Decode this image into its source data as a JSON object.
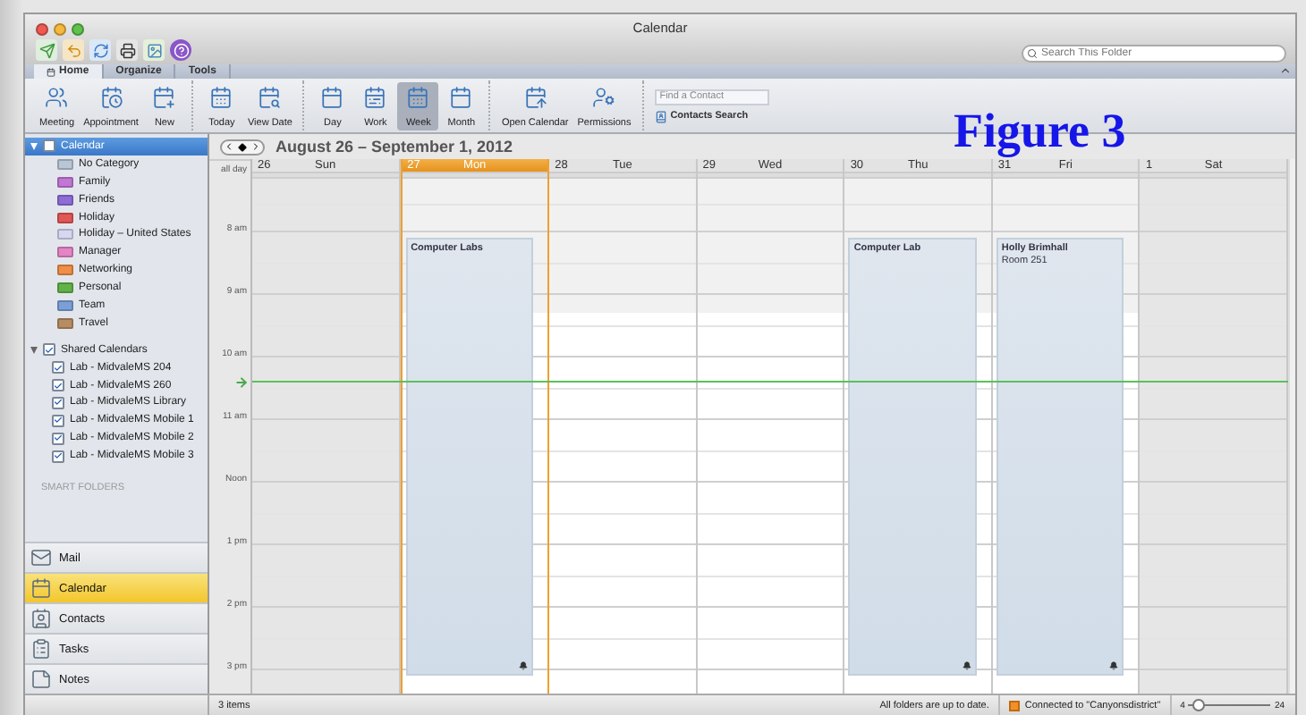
{
  "window": {
    "title": "Calendar"
  },
  "search": {
    "placeholder": "Search This Folder"
  },
  "tabs": [
    {
      "label": "Home",
      "selected": true
    },
    {
      "label": "Organize",
      "selected": false
    },
    {
      "label": "Tools",
      "selected": false
    }
  ],
  "ribbon": {
    "groups": [
      [
        {
          "label": "Meeting",
          "kind": "meeting",
          "selected": false
        },
        {
          "label": "Appointment",
          "kind": "appointment",
          "selected": false
        },
        {
          "label": "New",
          "kind": "new",
          "selected": false
        }
      ],
      [
        {
          "label": "Today",
          "kind": "today",
          "selected": false
        },
        {
          "label": "View Date",
          "kind": "viewdate",
          "selected": false
        }
      ],
      [
        {
          "label": "Day",
          "kind": "day",
          "selected": false
        },
        {
          "label": "Work",
          "kind": "work",
          "selected": false
        },
        {
          "label": "Week",
          "kind": "week",
          "selected": true
        },
        {
          "label": "Month",
          "kind": "month",
          "selected": false
        }
      ],
      [
        {
          "label": "Open Calendar",
          "kind": "open",
          "selected": false
        },
        {
          "label": "Permissions",
          "kind": "permissions",
          "selected": false
        }
      ]
    ],
    "find_contact": {
      "placeholder": "Find a Contact"
    },
    "contacts_search": "Contacts Search"
  },
  "figure_label": "Figure 3",
  "sidebar": {
    "calendar": {
      "label": "Calendar",
      "checked": false,
      "expanded": true,
      "selected": true,
      "categories": [
        {
          "label": "No Category",
          "color": "#b9c6d6"
        },
        {
          "label": "Family",
          "color": "#c276d6"
        },
        {
          "label": "Friends",
          "color": "#8e6cd8"
        },
        {
          "label": "Holiday",
          "color": "#e25656"
        },
        {
          "label": "Holiday – United States",
          "color": "#d6d8f2"
        },
        {
          "label": "Manager",
          "color": "#e485c6"
        },
        {
          "label": "Networking",
          "color": "#f08e46"
        },
        {
          "label": "Personal",
          "color": "#62b24a"
        },
        {
          "label": "Team",
          "color": "#7c9fd8"
        },
        {
          "label": "Travel",
          "color": "#b68c62"
        }
      ]
    },
    "shared": {
      "label": "Shared Calendars",
      "checked": true,
      "expanded": true,
      "children": [
        {
          "label": "Lab - MidvaleMS 204",
          "checked": true
        },
        {
          "label": "Lab - MidvaleMS 260",
          "checked": true
        },
        {
          "label": "Lab - MidvaleMS Library",
          "checked": true
        },
        {
          "label": "Lab - MidvaleMS Mobile 1",
          "checked": true
        },
        {
          "label": "Lab - MidvaleMS Mobile 2",
          "checked": true
        },
        {
          "label": "Lab - MidvaleMS Mobile 3",
          "checked": true
        }
      ]
    },
    "smart_folders": "SMART FOLDERS"
  },
  "nav": [
    {
      "label": "Mail",
      "kind": "mail",
      "selected": false
    },
    {
      "label": "Calendar",
      "kind": "calendar",
      "selected": true
    },
    {
      "label": "Contacts",
      "kind": "contacts",
      "selected": false
    },
    {
      "label": "Tasks",
      "kind": "tasks",
      "selected": false
    },
    {
      "label": "Notes",
      "kind": "notes",
      "selected": false
    }
  ],
  "calendar": {
    "title": "August 26 – September 1, 2012",
    "all_day_label": "all day",
    "hours": [
      "8 am",
      "9 am",
      "10 am",
      "11 am",
      "Noon",
      "1 pm",
      "2 pm",
      "3 pm"
    ],
    "days": [
      {
        "number": "26",
        "name": "Sun",
        "selected": false,
        "weekend": true
      },
      {
        "number": "27",
        "name": "Mon",
        "selected": true,
        "weekend": false,
        "events": [
          {
            "title": "Computer Labs",
            "alarm": true
          }
        ]
      },
      {
        "number": "28",
        "name": "Tue",
        "selected": false,
        "weekend": false
      },
      {
        "number": "29",
        "name": "Wed",
        "selected": false,
        "weekend": false
      },
      {
        "number": "30",
        "name": "Thu",
        "selected": false,
        "weekend": false,
        "events": [
          {
            "title": "Computer Lab",
            "alarm": true
          }
        ]
      },
      {
        "number": "31",
        "name": "Fri",
        "selected": false,
        "weekend": false,
        "events": [
          {
            "title": "Holly Brimhall",
            "location": "Room 251",
            "alarm": true
          }
        ]
      },
      {
        "number": "1",
        "name": "Sat",
        "selected": false,
        "weekend": true
      }
    ]
  },
  "status_bar": {
    "items": "3 items",
    "sync": "All folders are up to date.",
    "connection": "Connected to \"Canyonsdistrict\"",
    "zoom": {
      "min": "4",
      "max": "24",
      "level": 0.12
    }
  }
}
